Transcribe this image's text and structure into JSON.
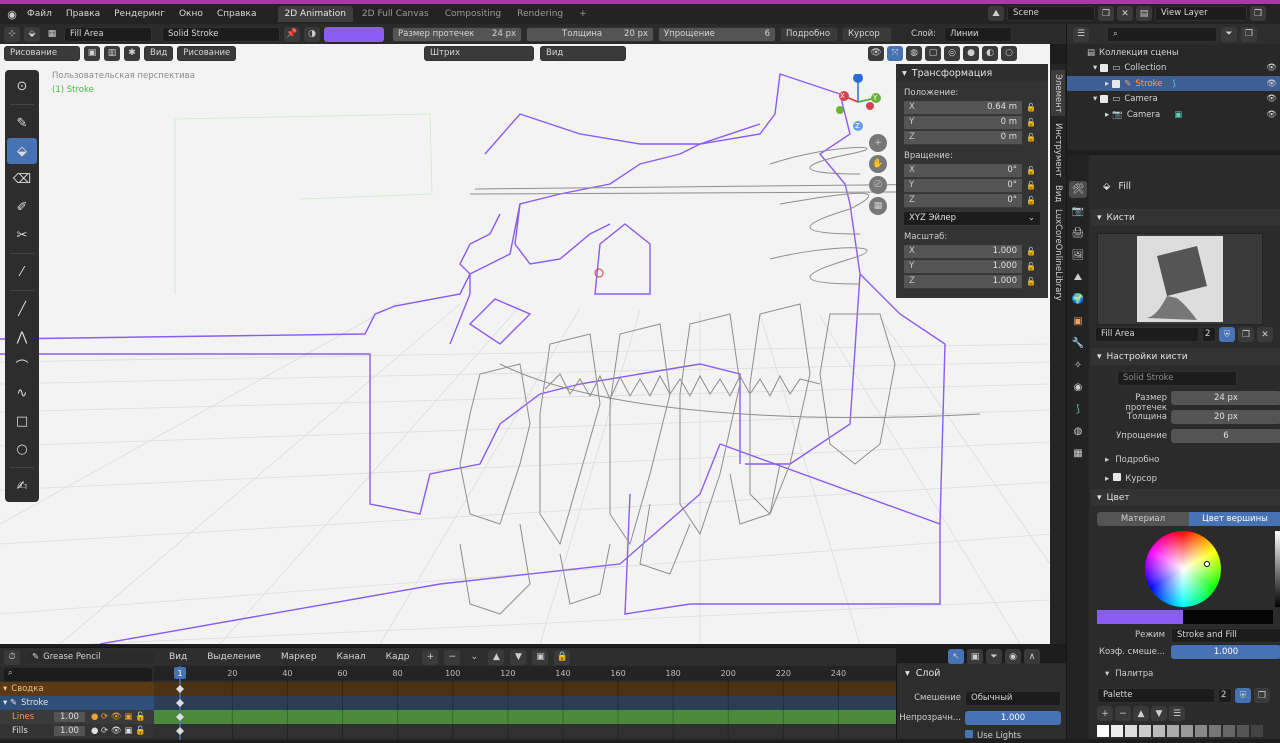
{
  "menu": [
    "Файл",
    "Правка",
    "Рендеринг",
    "Окно",
    "Справка"
  ],
  "workspaces": [
    "2D Animation",
    "2D Full Canvas",
    "Compositing",
    "Rendering"
  ],
  "scene": "Scene",
  "view_layer": "View Layer",
  "brush_name": "Fill Area",
  "material": "Solid Stroke",
  "tool_settings": {
    "size_label": "Размер протечек",
    "size_val": "24 px",
    "thickness_label": "Толщина",
    "thickness_val": "20 px",
    "simplify_label": "Упрощение",
    "simplify_val": "6",
    "detail": "Подробно",
    "cursor": "Курсор",
    "layer_label": "Слой:",
    "layer_val": "Линии"
  },
  "vp_header": {
    "mode": "Рисование",
    "view": "Вид",
    "draw": "Рисование",
    "stroke": "Штрих",
    "view2": "Вид"
  },
  "overlay_text": {
    "line1": "Пользовательская перспектива",
    "line2": "(1) Stroke"
  },
  "npanel": {
    "title": "Трансформация",
    "location_label": "Положение:",
    "loc": [
      {
        "ax": "X",
        "val": "0.64 m"
      },
      {
        "ax": "Y",
        "val": "0 m"
      },
      {
        "ax": "Z",
        "val": "0 m"
      }
    ],
    "rotation_label": "Вращение:",
    "rot": [
      {
        "ax": "X",
        "val": "0°"
      },
      {
        "ax": "Y",
        "val": "0°"
      },
      {
        "ax": "Z",
        "val": "0°"
      }
    ],
    "rot_mode": "XYZ Эйлер",
    "scale_label": "Масштаб:",
    "scale": [
      {
        "ax": "X",
        "val": "1.000"
      },
      {
        "ax": "Y",
        "val": "1.000"
      },
      {
        "ax": "Z",
        "val": "1.000"
      }
    ]
  },
  "vtabs": [
    "Элемент",
    "Инструмент",
    "Вид",
    "LuxCoreOnlineLibrary"
  ],
  "gizmo": {
    "x": "X",
    "y": "Y",
    "z": "Z"
  },
  "outliner": {
    "title": "Коллекция сцены",
    "collection": "Collection",
    "stroke": "Stroke",
    "camera_coll": "Camera",
    "camera": "Camera"
  },
  "props": {
    "tool": "Fill",
    "brushes": "Кисти",
    "brush": "Fill Area",
    "users": "2",
    "brush_settings": "Настройки кисти",
    "material": "Solid Stroke",
    "size_label": "Размер протечек",
    "size_val": "24 px",
    "thick_label": "Толщина",
    "thick_val": "20 px",
    "simp_label": "Упрощение",
    "simp_val": "6",
    "detail": "Подробно",
    "cursor": "Курсор",
    "color": "Цвет",
    "tab_material": "Материал",
    "tab_vertex": "Цвет вершины",
    "mode_label": "Режим",
    "mode_val": "Stroke and Fill",
    "mix_label": "Коэф. смеше...",
    "mix_val": "1.000",
    "palette": "Палитра",
    "palette_name": "Palette",
    "palette_users": "2"
  },
  "timeline": {
    "editor": "Grease Pencil",
    "menus": [
      "Вид",
      "Выделение",
      "Маркер",
      "Канал",
      "Кадр"
    ],
    "frames": [
      "1",
      "20",
      "40",
      "60",
      "80",
      "100",
      "120",
      "140",
      "160",
      "180",
      "200",
      "220",
      "240"
    ],
    "channels": [
      {
        "name": "Сводка",
        "val": ""
      },
      {
        "name": "Stroke",
        "val": ""
      },
      {
        "name": "Lines",
        "val": "1.00"
      },
      {
        "name": "Fills",
        "val": "1.00"
      }
    ]
  },
  "layer_panel": {
    "title": "Слой",
    "blend_label": "Смешение",
    "blend_val": "Обычный",
    "opacity_label": "Непрозрачн...",
    "opacity_val": "1.000",
    "lights": "Use Lights"
  },
  "colors": {
    "accent": "#4772b3",
    "stroke": "#8a5cf0",
    "keyframe_bar": "#4b8a3a"
  }
}
